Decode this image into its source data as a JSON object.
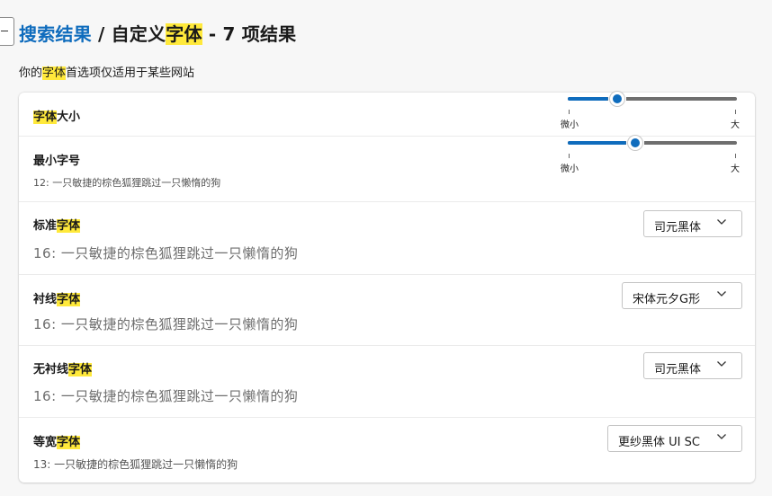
{
  "header": {
    "breadcrumb_link": "搜索结果",
    "separator": " / ",
    "title_prefix": "自定义",
    "title_highlight": "字体",
    "title_suffix": " - 7 项结果"
  },
  "subtitle": {
    "prefix": "你的",
    "highlight": "字体",
    "suffix": "首选项仅适用于某些网站"
  },
  "font_size": {
    "label_highlight": "字体",
    "label_suffix": "大小",
    "value_fraction": 0.29,
    "min_label": "微小",
    "max_label": "大"
  },
  "min_font_size": {
    "label": "最小字号",
    "sample": "12: 一只敏捷的棕色狐狸跳过一只懒惰的狗",
    "value_fraction": 0.4,
    "min_label": "微小",
    "max_label": "大"
  },
  "standard_font": {
    "label_prefix": "标准",
    "label_highlight": "字体",
    "sample": "16:  一只敏捷的棕色狐狸跳过一只懒惰的狗",
    "selected": "司元黑体"
  },
  "serif_font": {
    "label_prefix": "衬线",
    "label_highlight": "字体",
    "sample": "16:  一只敏捷的棕色狐狸跳过一只懒惰的狗",
    "selected": "宋体元夕G形"
  },
  "sans_serif_font": {
    "label_prefix": "无衬线",
    "label_highlight": "字体",
    "sample": "16:  一只敏捷的棕色狐狸跳过一只懒惰的狗",
    "selected": "司元黑体"
  },
  "monospace_font": {
    "label_prefix": "等宽",
    "label_highlight": "字体",
    "sample": "13: 一只敏捷的棕色狐狸跳过一只懒惰的狗",
    "selected": "更纱黑体 UI SC"
  },
  "colors": {
    "accent": "#0f6cbd",
    "highlight": "#ffe93b",
    "track": "#6e6e6e"
  }
}
